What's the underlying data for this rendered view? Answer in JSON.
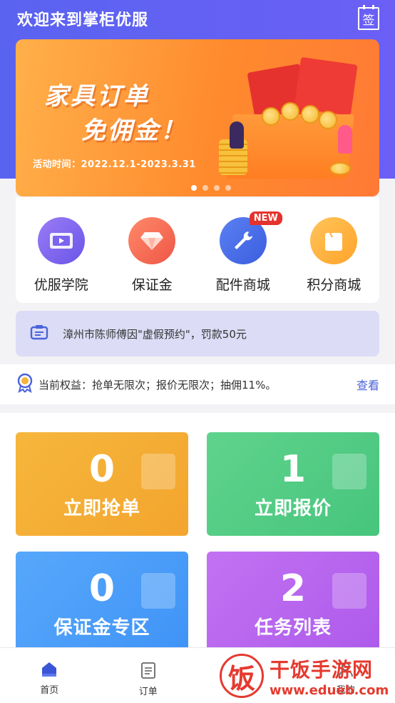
{
  "header": {
    "title": "欢迎来到掌柜优服",
    "checkin_label": "签"
  },
  "banner": {
    "headline1": "家具订单",
    "headline2": "免佣金！",
    "period": "活动时间：2022.12.1-2023.3.31",
    "slides": 4,
    "active_slide": 0
  },
  "quick_menu": [
    {
      "label": "优服学院",
      "icon": "play-book-icon",
      "color": "#7c63f0"
    },
    {
      "label": "保证金",
      "icon": "diamond-icon",
      "color": "#f26a5a"
    },
    {
      "label": "配件商城",
      "icon": "wrench-icon",
      "color": "#4a6ee8",
      "badge": "NEW"
    },
    {
      "label": "积分商城",
      "icon": "bag-icon",
      "color": "#ffb03a"
    }
  ],
  "notice": {
    "text": "漳州市陈师傅因\"虚假预约\"，罚款50元"
  },
  "rights": {
    "text": "当前权益：抢单无限次；报价无限次；抽佣11%。",
    "link": "查看"
  },
  "cards": [
    {
      "count": "0",
      "label": "立即抢单"
    },
    {
      "count": "1",
      "label": "立即报价"
    },
    {
      "count": "0",
      "label": "保证金专区"
    },
    {
      "count": "2",
      "label": "任务列表"
    }
  ],
  "tabs": [
    {
      "label": "首页"
    },
    {
      "label": "订单"
    },
    {
      "label": "消息"
    },
    {
      "label": "我的"
    }
  ],
  "watermark": {
    "logo": "饭",
    "title": "干饭手游网",
    "url": "www.edueb.com"
  }
}
